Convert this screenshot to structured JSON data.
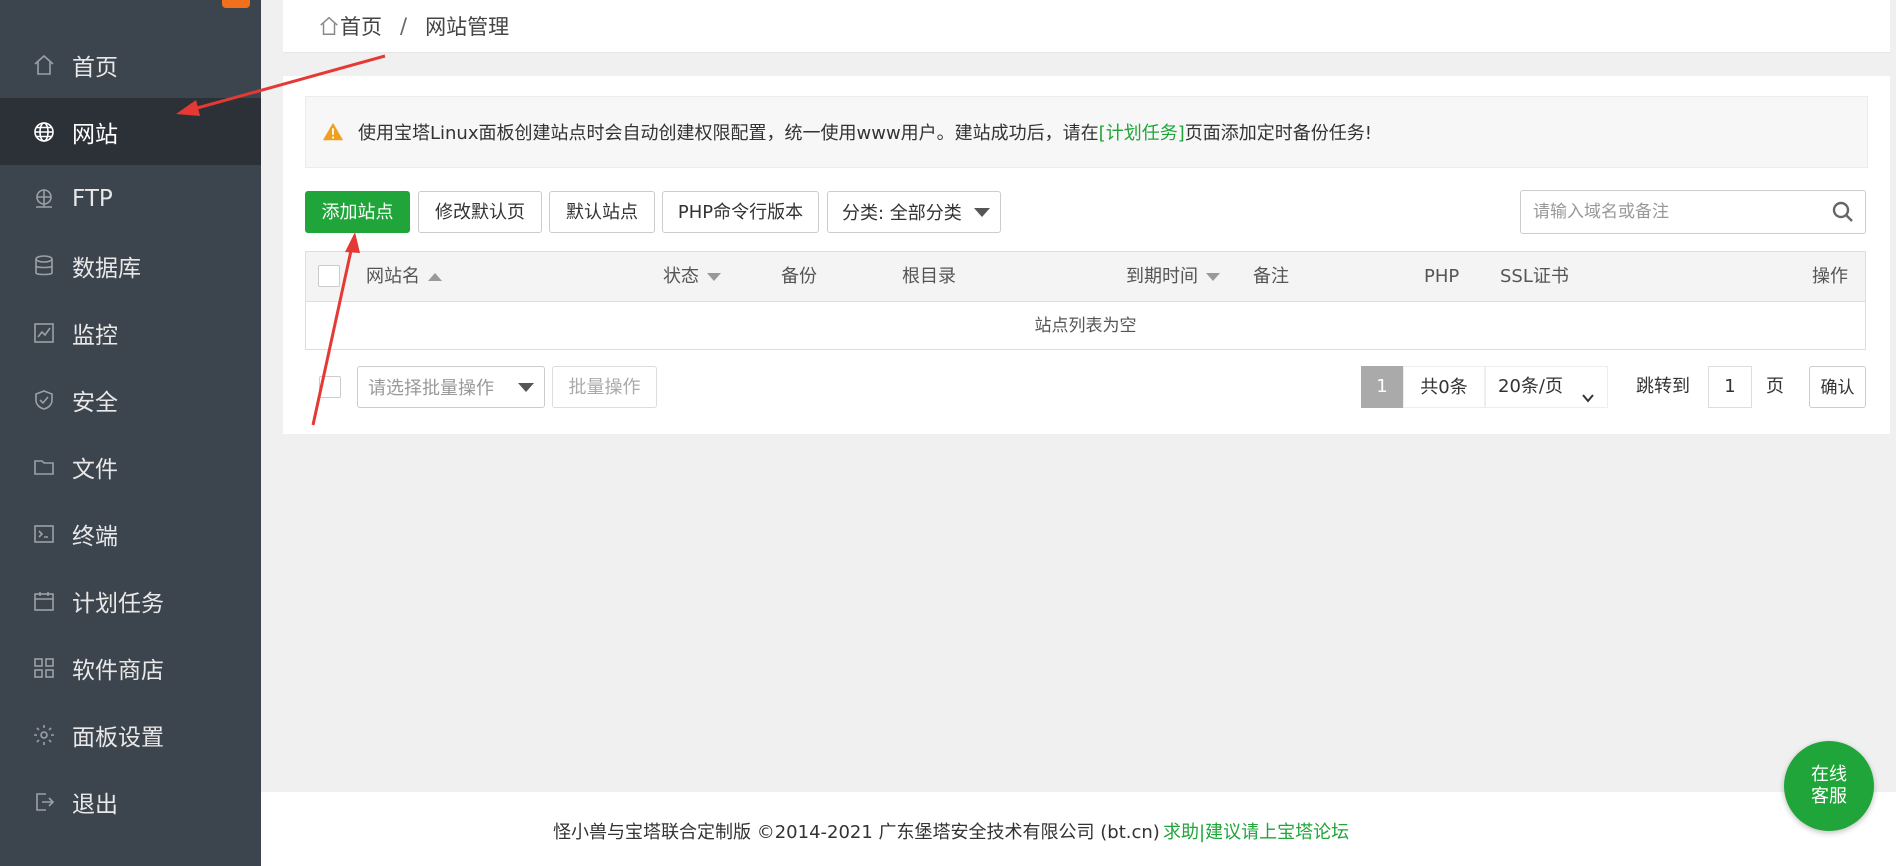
{
  "sidebar": {
    "items": [
      {
        "label": "首页",
        "icon": "home-icon"
      },
      {
        "label": "网站",
        "icon": "globe-icon",
        "active": true
      },
      {
        "label": "FTP",
        "icon": "ftp-icon"
      },
      {
        "label": "数据库",
        "icon": "database-icon"
      },
      {
        "label": "监控",
        "icon": "monitor-icon"
      },
      {
        "label": "安全",
        "icon": "shield-icon"
      },
      {
        "label": "文件",
        "icon": "folder-icon"
      },
      {
        "label": "终端",
        "icon": "terminal-icon"
      },
      {
        "label": "计划任务",
        "icon": "calendar-icon"
      },
      {
        "label": "软件商店",
        "icon": "apps-icon"
      },
      {
        "label": "面板设置",
        "icon": "gear-icon"
      },
      {
        "label": "退出",
        "icon": "logout-icon"
      }
    ]
  },
  "breadcrumb": {
    "home": "首页",
    "separator": "/",
    "current": "网站管理"
  },
  "alert": {
    "text_before": "使用宝塔Linux面板创建站点时会自动创建权限配置，统一使用www用户。建站成功后，请在",
    "link": "[计划任务]",
    "text_after": "页面添加定时备份任务!"
  },
  "toolbar": {
    "add_site": "添加站点",
    "edit_default_page": "修改默认页",
    "default_site": "默认站点",
    "php_cli": "PHP命令行版本",
    "category": "分类: 全部分类",
    "search_placeholder": "请输入域名或备注"
  },
  "table": {
    "headers": {
      "name": "网站名",
      "status": "状态",
      "backup": "备份",
      "root": "根目录",
      "expire": "到期时间",
      "remark": "备注",
      "php": "PHP",
      "ssl": "SSL证书",
      "actions": "操作"
    },
    "empty_text": "站点列表为空"
  },
  "batch": {
    "placeholder": "请选择批量操作",
    "button": "批量操作"
  },
  "pagination": {
    "current_page": "1",
    "total": "共0条",
    "per_page": "20条/页",
    "jump_label": "跳转到",
    "jump_value": "1",
    "page_unit": "页",
    "confirm": "确认"
  },
  "footer": {
    "copyright": "怪小兽与宝塔联合定制版 ©2014-2021 广东堡塔安全技术有限公司 (bt.cn)",
    "forum_link": "求助|建议请上宝塔论坛"
  },
  "service": {
    "line1": "在线",
    "line2": "客服"
  },
  "colors": {
    "sidebar": "#3c444d",
    "accent": "#20a53a",
    "annotation_arrow": "#e53935"
  }
}
